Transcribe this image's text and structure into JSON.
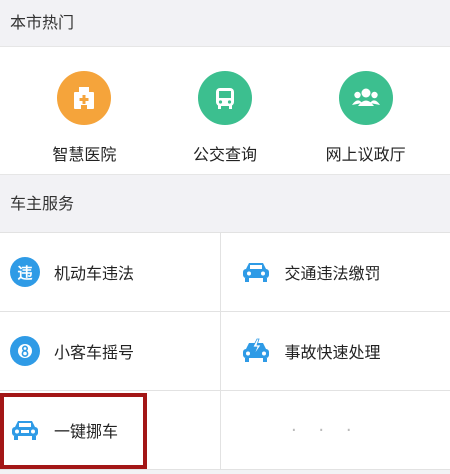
{
  "hot_section": {
    "title": "本市热门",
    "items": [
      {
        "label": "智慧医院",
        "icon": "hospital-icon",
        "color": "#f5a43b"
      },
      {
        "label": "公交查询",
        "icon": "bus-icon",
        "color": "#3cbf8f"
      },
      {
        "label": "网上议政厅",
        "icon": "people-icon",
        "color": "#3cbf8f"
      }
    ]
  },
  "car_section": {
    "title": "车主服务",
    "rows": [
      [
        {
          "label": "机动车违法",
          "icon": "violation-icon",
          "color": "#2f9be6",
          "glyph": "违"
        },
        {
          "label": "交通违法缴罚",
          "icon": "car-icon",
          "color": "#2f9be6"
        }
      ],
      [
        {
          "label": "小客车摇号",
          "icon": "lottery-icon",
          "color": "#2f9be6"
        },
        {
          "label": "事故快速处理",
          "icon": "accident-car-icon",
          "color": "#2f9be6"
        }
      ],
      [
        {
          "label": "一键挪车",
          "icon": "move-car-icon",
          "color": "#2f9be6"
        },
        {
          "label": "· · ·",
          "icon": "more-icon"
        }
      ]
    ]
  },
  "highlight_color": "#a31616"
}
